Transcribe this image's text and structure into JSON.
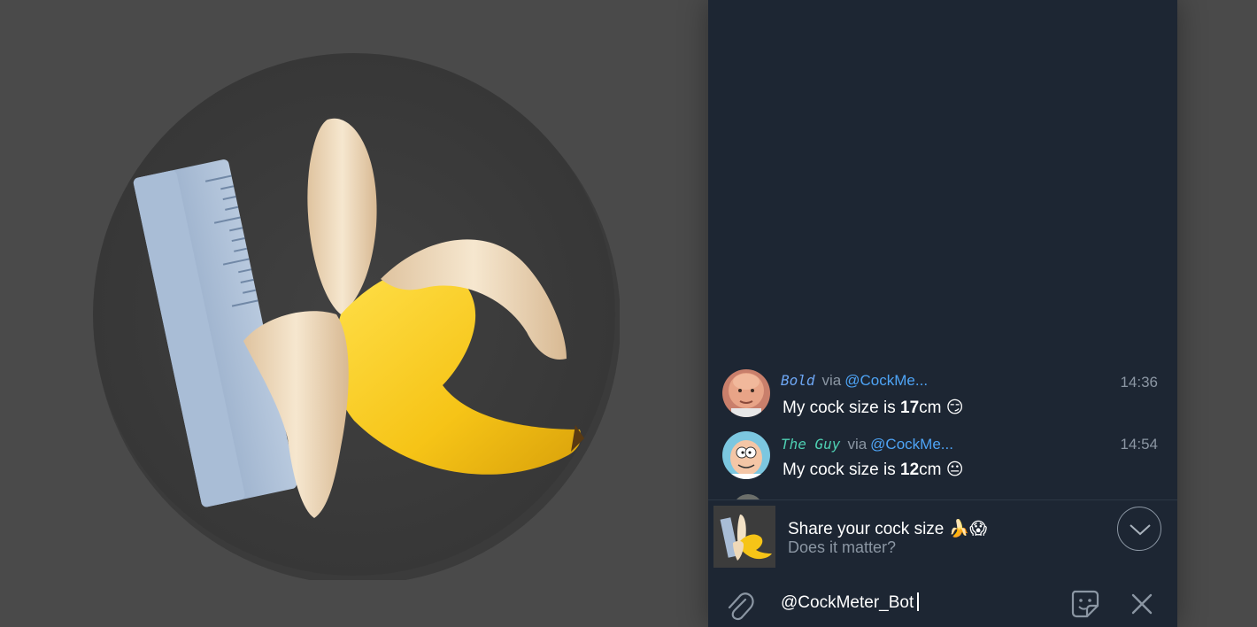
{
  "messages": [
    {
      "sender": "Bold",
      "sender_color": "#6ea7f5",
      "via_label": "via",
      "via_handle": "@CockMe...",
      "text_before": "My cock size is ",
      "size_value": "17",
      "size_unit": "cm",
      "emoji": "😏",
      "time": "14:36",
      "avatar_icon": "bald-man-avatar"
    },
    {
      "sender": "The Guy",
      "sender_color": "#4ecfb2",
      "via_label": "via",
      "via_handle": "@CockMe...",
      "text_before": "My cock size is ",
      "size_value": "12",
      "size_unit": "cm",
      "emoji": "😐",
      "time": "14:54",
      "avatar_icon": "cartoon-man-avatar"
    }
  ],
  "inline_result": {
    "title": "Share your cock size 🍌😱",
    "subtitle": "Does it matter?",
    "thumb_icon": "banana-ruler-icon"
  },
  "input": {
    "value": "@CockMeter_Bot"
  },
  "icons": {
    "attach": "paperclip-icon",
    "sticker": "sticker-icon",
    "close": "close-icon",
    "collapse": "chevron-down-icon"
  },
  "colors": {
    "panel_bg": "#1d2633",
    "link": "#4ea4f6",
    "muted": "#8b96a3",
    "page_bg": "#4a4a4a"
  }
}
